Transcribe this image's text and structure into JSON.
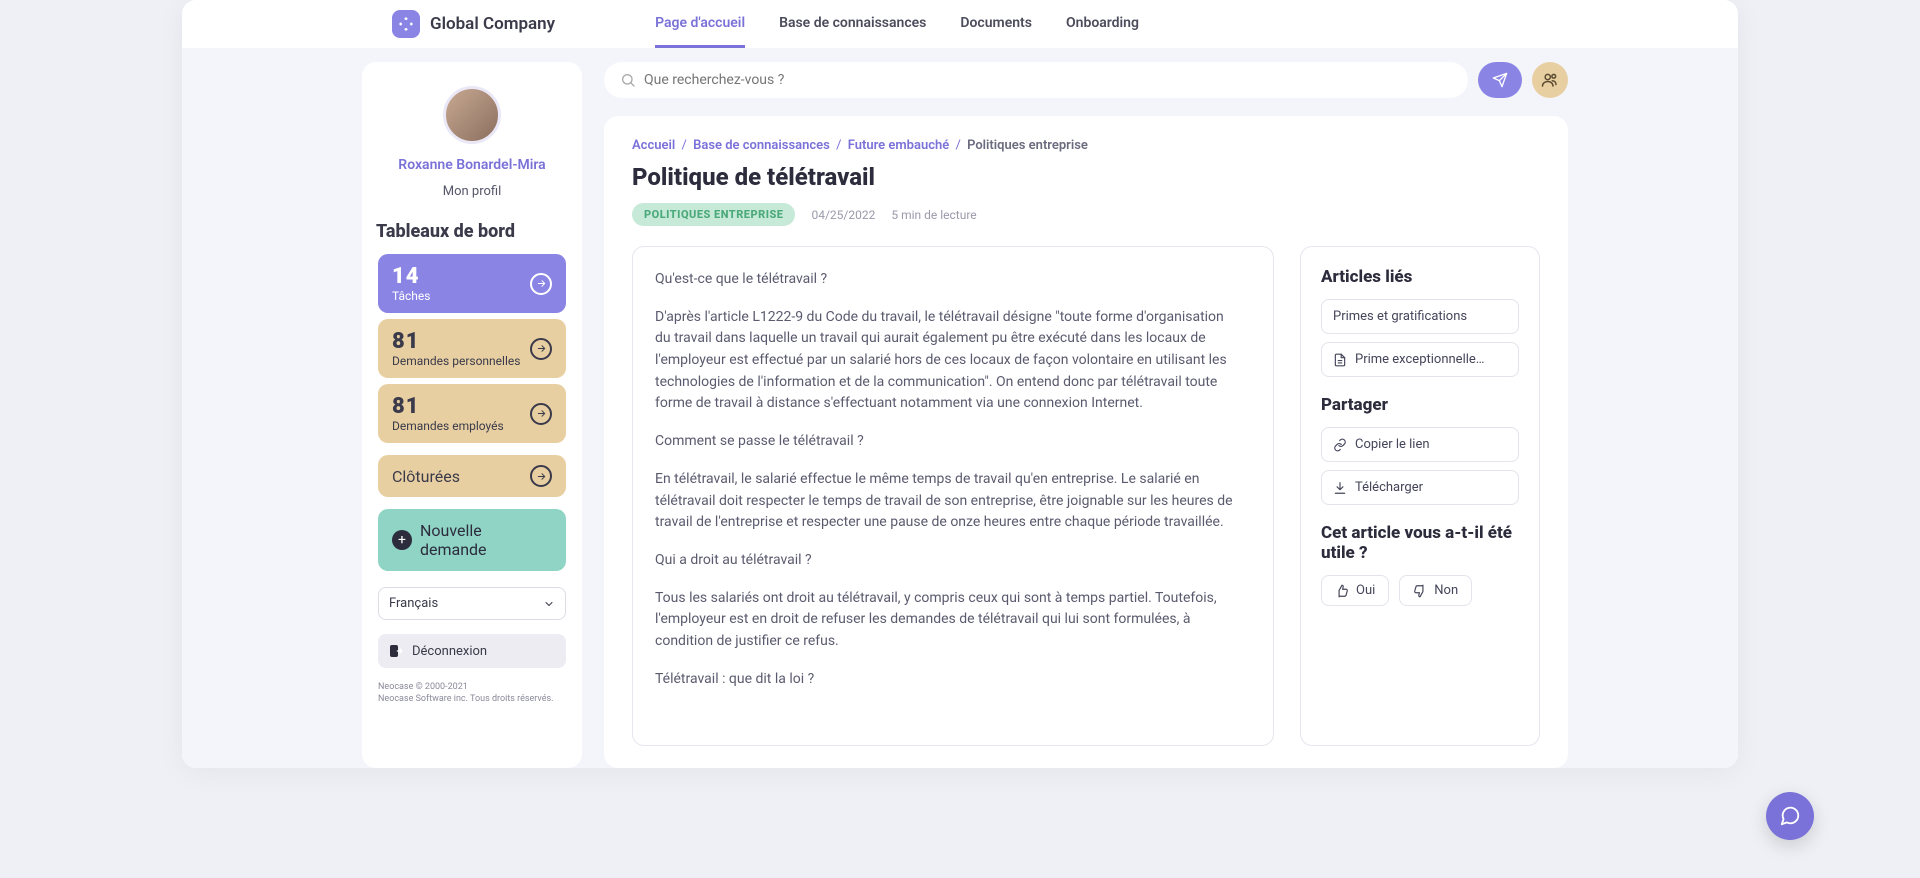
{
  "brand": "Global Company",
  "nav": [
    {
      "label": "Page d'accueil",
      "active": true
    },
    {
      "label": "Base de connaissances",
      "active": false
    },
    {
      "label": "Documents",
      "active": false
    },
    {
      "label": "Onboarding",
      "active": false
    }
  ],
  "search": {
    "placeholder": "Que recherchez-vous ?"
  },
  "user": {
    "name": "Roxanne Bonardel-Mira",
    "my_profile": "Mon profil"
  },
  "dashboards_title": "Tableaux de bord",
  "dash": [
    {
      "count": "14",
      "label": "Tâches",
      "style": "purple"
    },
    {
      "count": "81",
      "label": "Demandes personnelles",
      "style": "tan"
    },
    {
      "count": "81",
      "label": "Demandes employés",
      "style": "tan"
    }
  ],
  "closed_label": "Clôturées",
  "new_request_label": "Nouvelle demande",
  "language": "Français",
  "logout": "Déconnexion",
  "footer_line1": "Neocase © 2000-2021",
  "footer_line2": "Neocase Software inc. Tous droits réservés.",
  "breadcrumbs": [
    {
      "label": "Accueil",
      "link": true
    },
    {
      "label": "Base de connaissances",
      "link": true
    },
    {
      "label": "Future embauché",
      "link": true
    },
    {
      "label": "Politiques entreprise",
      "link": false
    }
  ],
  "page_title": "Politique de télétravail",
  "tag": "POLITIQUES ENTREPRISE",
  "date": "04/25/2022",
  "read_time": "5 min de lecture",
  "article": [
    "Qu'est-ce que le télétravail ?",
    "D'après l'article L1222-9 du Code du travail, le télétravail désigne \"toute forme d'organisation du travail dans laquelle un travail qui aurait également pu être exécuté dans les locaux de l'employeur est effectué par un salarié hors de ces locaux de façon volontaire en utilisant les technologies de l'information et de la communication\". On entend donc par télétravail toute forme de travail à distance s'effectuant notamment via une connexion Internet.",
    "Comment se passe le télétravail ?",
    "En télétravail, le salarié effectue le même temps de travail qu'en entreprise. Le salarié en télétravail doit respecter le temps de travail de son entreprise, être joignable sur les heures de travail de l'entreprise et respecter une pause de onze heures entre chaque période travaillée.",
    "Qui a droit au télétravail ?",
    "Tous les salariés ont droit au télétravail, y compris ceux qui sont à temps partiel. Toutefois, l'employeur est en droit de refuser les demandes de télétravail qui lui sont formulées, à condition de justifier ce refus.",
    "Télétravail : que dit la loi ?"
  ],
  "related_title": "Articles liés",
  "related": [
    {
      "label": "Primes et gratifications",
      "icon": null
    },
    {
      "label": "Prime exceptionnelle…",
      "icon": "doc"
    }
  ],
  "share_title": "Partager",
  "share": [
    {
      "label": "Copier le lien",
      "icon": "link"
    },
    {
      "label": "Télécharger",
      "icon": "download"
    }
  ],
  "useful_title": "Cet article vous a-t-il été utile ?",
  "vote_yes": "Oui",
  "vote_no": "Non"
}
